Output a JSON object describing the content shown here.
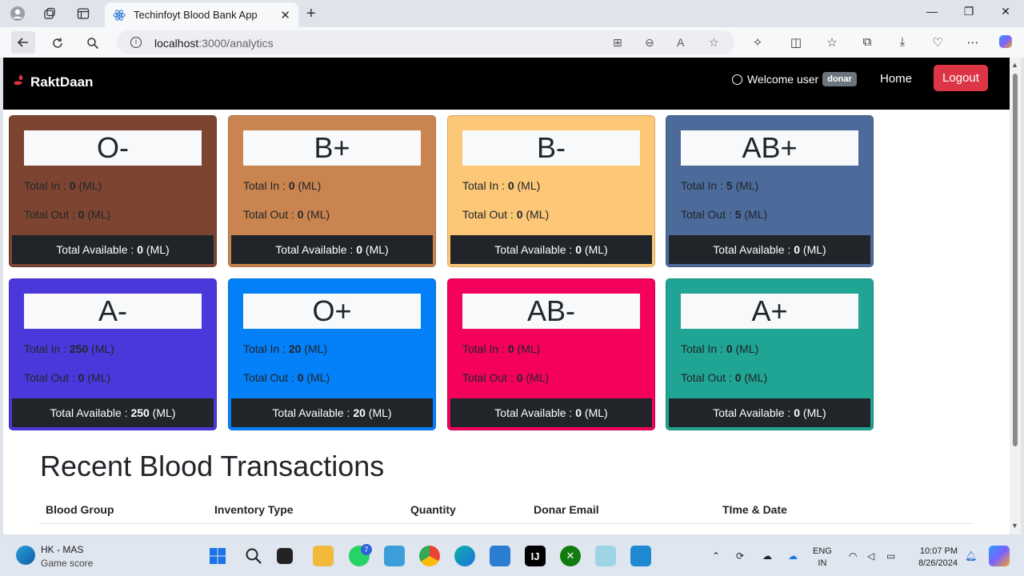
{
  "browser": {
    "tab_title": "Techinfoyt Blood Bank App",
    "url_host": "localhost",
    "url_path": ":3000/analytics"
  },
  "app": {
    "brand": "RaktDaan",
    "welcome_text": "Welcome user",
    "role": "donar",
    "home_label": "Home",
    "logout_label": "Logout"
  },
  "cards": [
    {
      "group": "O-",
      "total_in": "0",
      "total_out": "0",
      "available": "0",
      "color": "#7d4531"
    },
    {
      "group": "B+",
      "total_in": "0",
      "total_out": "0",
      "available": "0",
      "color": "#c9844f"
    },
    {
      "group": "B-",
      "total_in": "0",
      "total_out": "0",
      "available": "0",
      "color": "#fcc777"
    },
    {
      "group": "AB+",
      "total_in": "5",
      "total_out": "5",
      "available": "0",
      "color": "#4c6b9a"
    },
    {
      "group": "A-",
      "total_in": "250",
      "total_out": "0",
      "available": "250",
      "color": "#4b38db"
    },
    {
      "group": "O+",
      "total_in": "20",
      "total_out": "0",
      "available": "20",
      "color": "#0480f8"
    },
    {
      "group": "AB-",
      "total_in": "0",
      "total_out": "0",
      "available": "0",
      "color": "#f4015e"
    },
    {
      "group": "A+",
      "total_in": "0",
      "total_out": "0",
      "available": "0",
      "color": "#20a493"
    }
  ],
  "labels": {
    "total_in": "Total In : ",
    "total_out": "Total Out : ",
    "total_available": "Total Available : ",
    "unit": " (ML)"
  },
  "transactions": {
    "title": "Recent Blood Transactions",
    "columns": [
      "Blood Group",
      "Inventory Type",
      "Quantity",
      "Donar Email",
      "TIme & Date"
    ]
  },
  "taskbar": {
    "weather_title": "HK - MAS",
    "weather_sub": "Game score",
    "whatsapp_badge": "7",
    "lang_1": "ENG",
    "lang_2": "IN",
    "time": "10:07 PM",
    "date": "8/26/2024"
  }
}
